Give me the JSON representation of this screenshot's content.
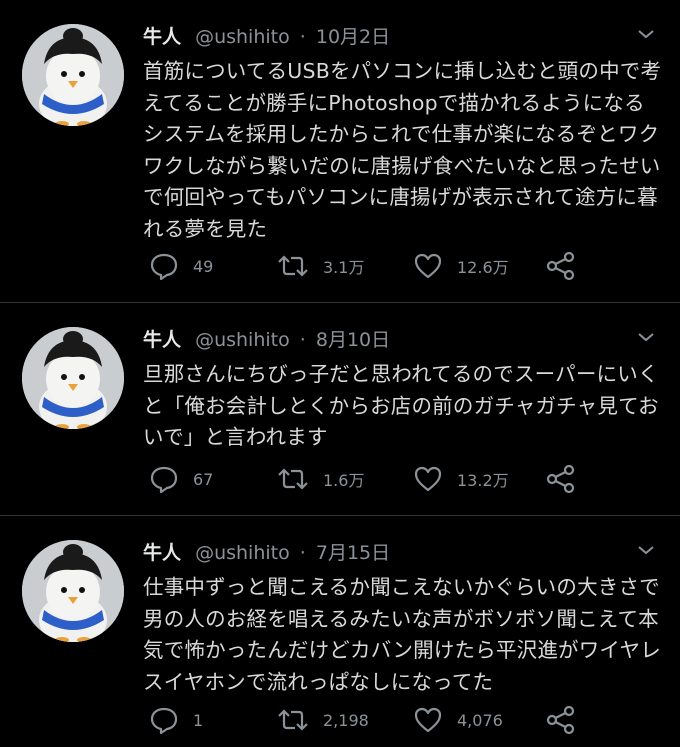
{
  "tweets": [
    {
      "name": "牛人",
      "handle": "@ushihito",
      "separator": "·",
      "date": "10月2日",
      "text": "首筋についてるUSBをパソコンに挿し込むと頭の中で考えてることが勝手にPhotoshopで描かれるようになるシステムを採用したからこれで仕事が楽になるぞとワクワクしながら繋いだのに唐揚げ食べたいなと思ったせいで何回やってもパソコンに唐揚げが表示されて途方に暮れる夢を見た",
      "replies": "49",
      "retweets": "3.1万",
      "likes": "12.6万"
    },
    {
      "name": "牛人",
      "handle": "@ushihito",
      "separator": "·",
      "date": "8月10日",
      "text": "旦那さんにちびっ子だと思われてるのでスーパーにいくと「俺お会計しとくからお店の前のガチャガチャ見ておいで」と言われます",
      "replies": "67",
      "retweets": "1.6万",
      "likes": "13.2万"
    },
    {
      "name": "牛人",
      "handle": "@ushihito",
      "separator": "·",
      "date": "7月15日",
      "text": "仕事中ずっと聞こえるか聞こえないかぐらいの大きさで男の人のお経を唱えるみたいな声がボソボソ聞こえて本気で怖かったんだけどカバン開けたら平沢進がワイヤレスイヤホンで流れっぱなしになってた",
      "replies": "1",
      "retweets": "2,198",
      "likes": "4,076"
    }
  ],
  "icons": {
    "reply": "reply-icon",
    "retweet": "retweet-icon",
    "like": "heart-icon",
    "share": "share-icon",
    "more": "chevron-down-icon"
  },
  "colors": {
    "background": "#000000",
    "text": "#d9d9d9",
    "secondary": "#8b9298",
    "divider": "#2f3336"
  }
}
